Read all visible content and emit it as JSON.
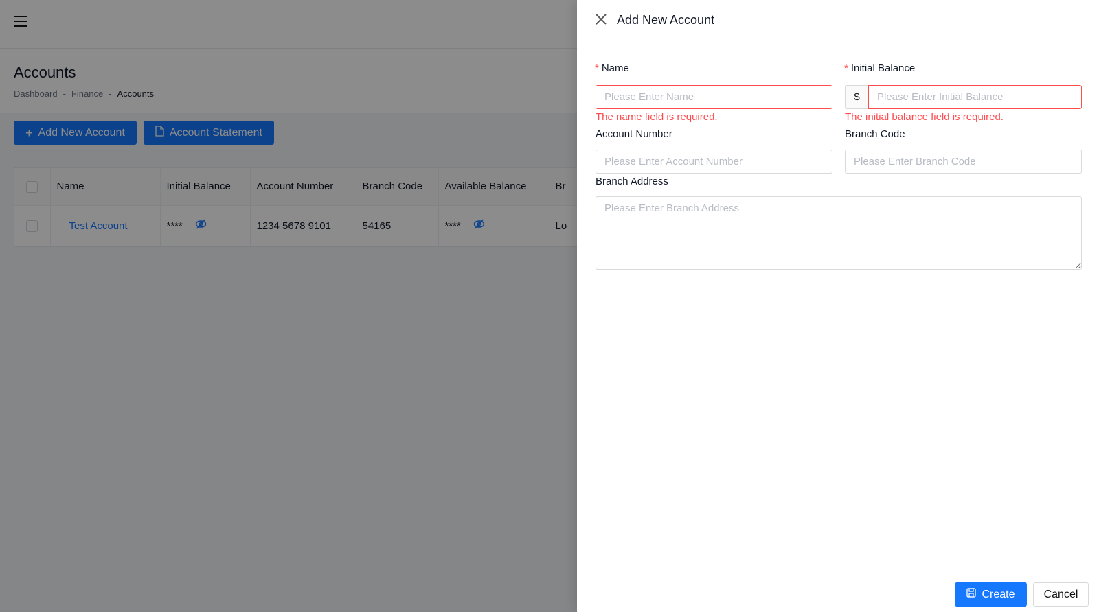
{
  "page": {
    "title": "Accounts",
    "breadcrumb": [
      "Dashboard",
      "-",
      "Finance",
      "-",
      "Accounts"
    ],
    "buttons": {
      "add_new_account": "Add New Account",
      "account_statement": "Account Statement"
    },
    "table": {
      "columns": [
        "Name",
        "Initial Balance",
        "Account Number",
        "Branch Code",
        "Available Balance",
        "Br"
      ],
      "rows": [
        {
          "name": "Test Account",
          "initial_balance": "****",
          "account_number": "1234 5678 9101",
          "branch_code": "54165",
          "available_balance": "****",
          "branch": "Lo"
        }
      ]
    }
  },
  "drawer": {
    "title": "Add New Account",
    "fields": {
      "name": {
        "label": "Name",
        "placeholder": "Please Enter Name",
        "error": "The name field is required.",
        "required_mark": "*"
      },
      "initial_balance": {
        "label": "Initial Balance",
        "placeholder": "Please Enter Initial Balance",
        "error": "The initial balance field is required.",
        "prefix": "$",
        "required_mark": "*"
      },
      "account_number": {
        "label": "Account Number",
        "placeholder": "Please Enter Account Number"
      },
      "branch_code": {
        "label": "Branch Code",
        "placeholder": "Please Enter Branch Code"
      },
      "branch_address": {
        "label": "Branch Address",
        "placeholder": "Please Enter Branch Address"
      }
    },
    "footer": {
      "create": "Create",
      "cancel": "Cancel"
    }
  },
  "colors": {
    "primary": "#1677ff",
    "error": "#ff4d4f"
  },
  "icons": [
    "hamburger-icon",
    "plus-icon",
    "pdf-file-icon",
    "eye-slash-icon",
    "close-icon",
    "save-icon"
  ]
}
